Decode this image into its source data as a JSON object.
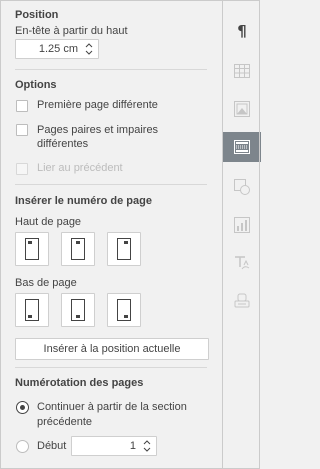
{
  "position": {
    "title": "Position",
    "header_label": "En-tête à partir du haut",
    "header_value": "1.25 cm"
  },
  "options": {
    "title": "Options",
    "first_page": "Première page différente",
    "odd_even_1": "Pages paires et impaires",
    "odd_even_2": "différentes",
    "link_previous": "Lier au précédent"
  },
  "page_number": {
    "title": "Insérer le numéro de page",
    "top_label": "Haut de page",
    "bottom_label": "Bas de page",
    "insert_button": "Insérer à la position actuelle"
  },
  "numbering": {
    "title": "Numérotation des pages",
    "continue_1": "Continuer à partir de la section",
    "continue_2": "précédente",
    "start_label": "Début",
    "start_value": "1"
  },
  "rail": {
    "items": [
      {
        "icon": "paragraph-icon",
        "label": "¶"
      },
      {
        "icon": "table-settings-icon"
      },
      {
        "icon": "image-settings-icon"
      },
      {
        "icon": "header-footer-settings-icon",
        "active": true
      },
      {
        "icon": "shape-settings-icon"
      },
      {
        "icon": "chart-settings-icon"
      },
      {
        "icon": "text-art-settings-icon"
      },
      {
        "icon": "signature-settings-icon"
      }
    ]
  }
}
